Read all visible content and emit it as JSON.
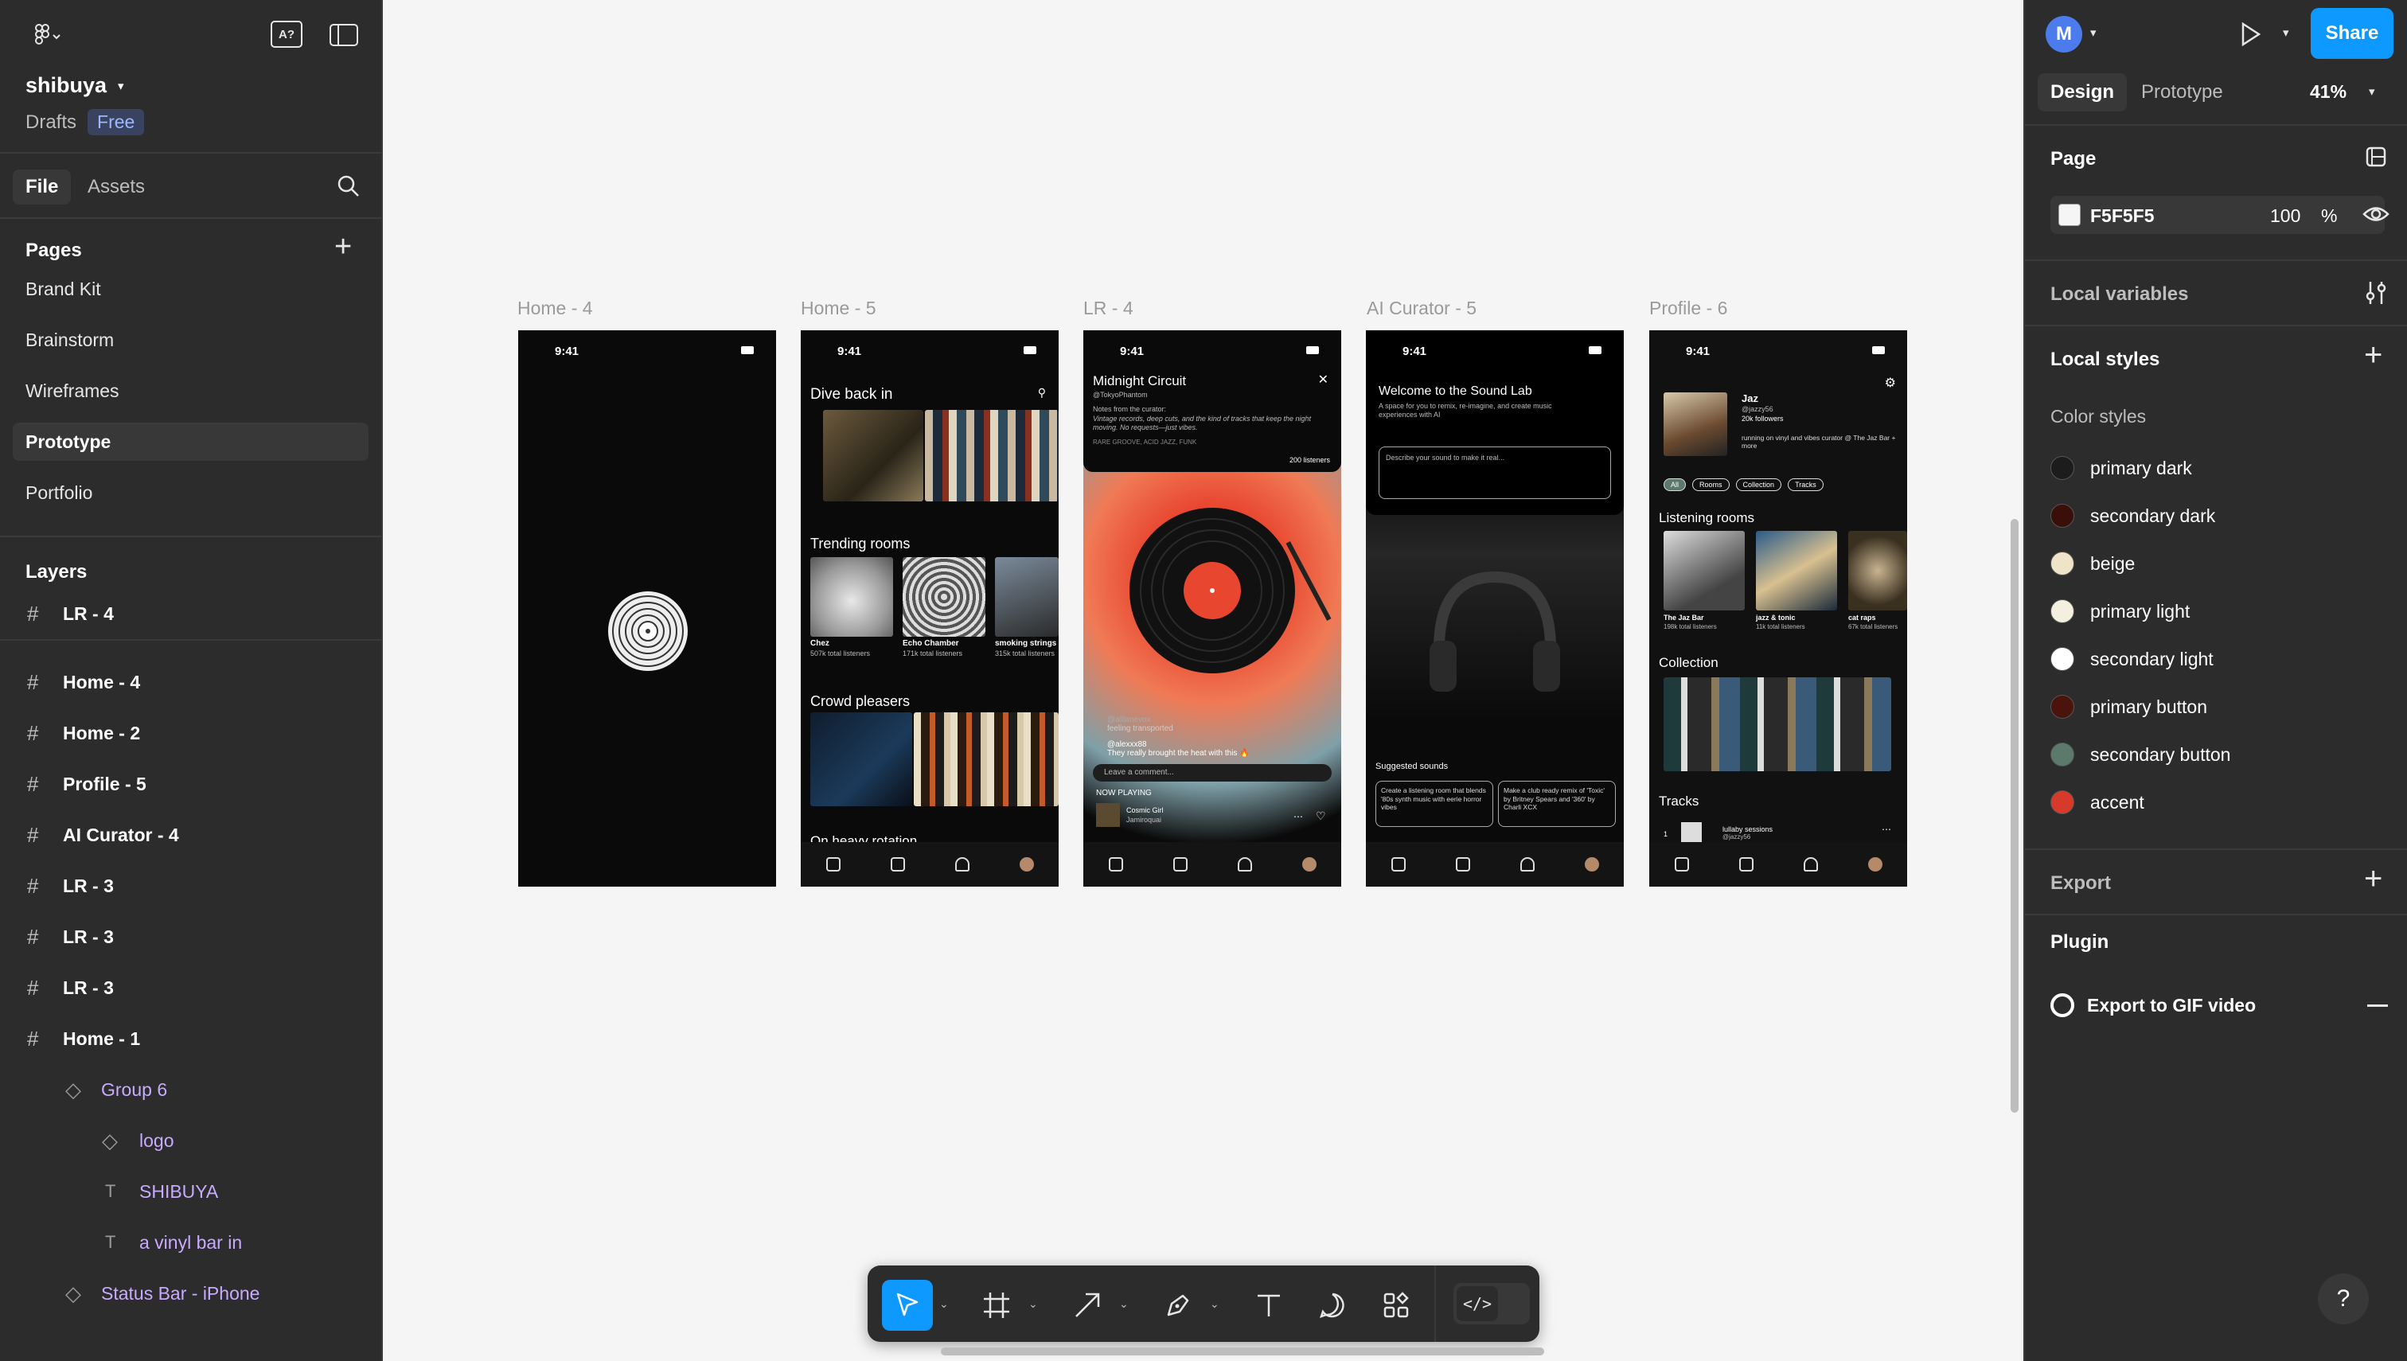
{
  "app": {
    "project_name": "shibuya",
    "location": "Drafts",
    "plan": "Free"
  },
  "left_tabs": [
    "File",
    "Assets"
  ],
  "pages": {
    "title": "Pages",
    "items": [
      "Brand Kit",
      "Brainstorm",
      "Wireframes",
      "Prototype",
      "Portfolio"
    ],
    "active": "Prototype"
  },
  "layers": {
    "title": "Layers",
    "pinned": "LR - 4",
    "items": [
      {
        "name": "Home - 4",
        "type": "frame"
      },
      {
        "name": "Home - 2",
        "type": "frame"
      },
      {
        "name": "Profile - 5",
        "type": "frame"
      },
      {
        "name": "AI Curator - 4",
        "type": "frame"
      },
      {
        "name": "LR - 3",
        "type": "frame"
      },
      {
        "name": "LR - 3",
        "type": "frame"
      },
      {
        "name": "LR - 3",
        "type": "frame"
      },
      {
        "name": "Home - 1",
        "type": "frame"
      },
      {
        "name": "Group 6",
        "type": "component"
      },
      {
        "name": "logo",
        "type": "component"
      },
      {
        "name": "SHIBUYA",
        "type": "text"
      },
      {
        "name": "a vinyl bar in",
        "type": "text"
      },
      {
        "name": "Status Bar - iPhone",
        "type": "component"
      }
    ]
  },
  "header": {
    "avatar_initial": "M",
    "share_label": "Share"
  },
  "right_tabs": [
    "Design",
    "Prototype"
  ],
  "zoom": "41%",
  "page_section": {
    "title": "Page",
    "color_hex": "F5F5F5",
    "opacity": "100",
    "opacity_unit": "%"
  },
  "local_variables": "Local variables",
  "local_styles": "Local styles",
  "color_styles": {
    "title": "Color styles",
    "items": [
      {
        "name": "primary dark",
        "color": "#1c1c1c"
      },
      {
        "name": "secondary dark",
        "color": "#3a0f0a"
      },
      {
        "name": "beige",
        "color": "#efe3c8"
      },
      {
        "name": "primary light",
        "color": "#f3f0df"
      },
      {
        "name": "secondary light",
        "color": "#ffffff"
      },
      {
        "name": "primary button",
        "color": "#4a140d"
      },
      {
        "name": "secondary button",
        "color": "#5b7a6b"
      },
      {
        "name": "accent",
        "color": "#d63a2b"
      }
    ]
  },
  "export": "Export",
  "plugin": {
    "title": "Plugin",
    "item": "Export to GIF video"
  },
  "frames": [
    {
      "label": "Home - 4",
      "time": "9:41"
    },
    {
      "label": "Home - 5",
      "time": "9:41",
      "h1": "Dive back in",
      "h2": "Trending rooms",
      "h3": "Crowd pleasers",
      "h4": "On heavy rotation",
      "rooms": [
        {
          "name": "Chez",
          "listeners": "507k total listeners"
        },
        {
          "name": "Echo Chamber",
          "listeners": "171k total listeners"
        },
        {
          "name": "smoking strings",
          "listeners": "315k total listeners"
        }
      ]
    },
    {
      "label": "LR - 4",
      "time": "9:41",
      "title": "Midnight Circuit",
      "handle": "@TokyoPhantom",
      "note_head": "Notes from the curator:",
      "note": "Vintage records, deep cuts, and the kind of tracks that keep the night moving. No requests—just vibes.",
      "genres": "RARE GROOVE, ACID JAZZ, FUNK",
      "listeners": "200 listeners",
      "comment1_user": "@alllanevox",
      "comment1": "feeling transported",
      "comment2_user": "@alexxx88",
      "comment2": "They really brought the heat with this 🔥",
      "comment_placeholder": "Leave a comment...",
      "now_playing": "NOW PLAYING",
      "track": "Cosmic Girl",
      "artist": "Jamiroquai"
    },
    {
      "label": "AI Curator - 5",
      "time": "9:41",
      "title": "Welcome to the Sound Lab",
      "subtitle": "A space for you to remix, re-imagine, and create music experiences with AI",
      "input_placeholder": "Describe your sound to make it real...",
      "suggested": "Suggested sounds",
      "s1": "Create a listening room that blends '80s synth music with eerie horror vibes",
      "s2": "Make a club ready remix of 'Toxic' by Britney Spears and '360' by Charli XCX"
    },
    {
      "label": "Profile - 6",
      "time": "9:41",
      "name": "Jaz",
      "handle": "@jazzy56",
      "followers": "20k followers",
      "bio": "running on vinyl and vibes curator @ The Jaz Bar + more",
      "chips": [
        "All",
        "Rooms",
        "Collection",
        "Tracks"
      ],
      "h_rooms": "Listening rooms",
      "h_collection": "Collection",
      "h_tracks": "Tracks",
      "rooms": [
        {
          "name": "The Jaz Bar",
          "listeners": "198k total listeners"
        },
        {
          "name": "jazz & tonic",
          "listeners": "11k total listeners"
        },
        {
          "name": "cat raps",
          "listeners": "67k total listeners"
        }
      ],
      "track1": "lullaby sessions",
      "track1_user": "@jazzy56",
      "track_num": "1"
    }
  ]
}
